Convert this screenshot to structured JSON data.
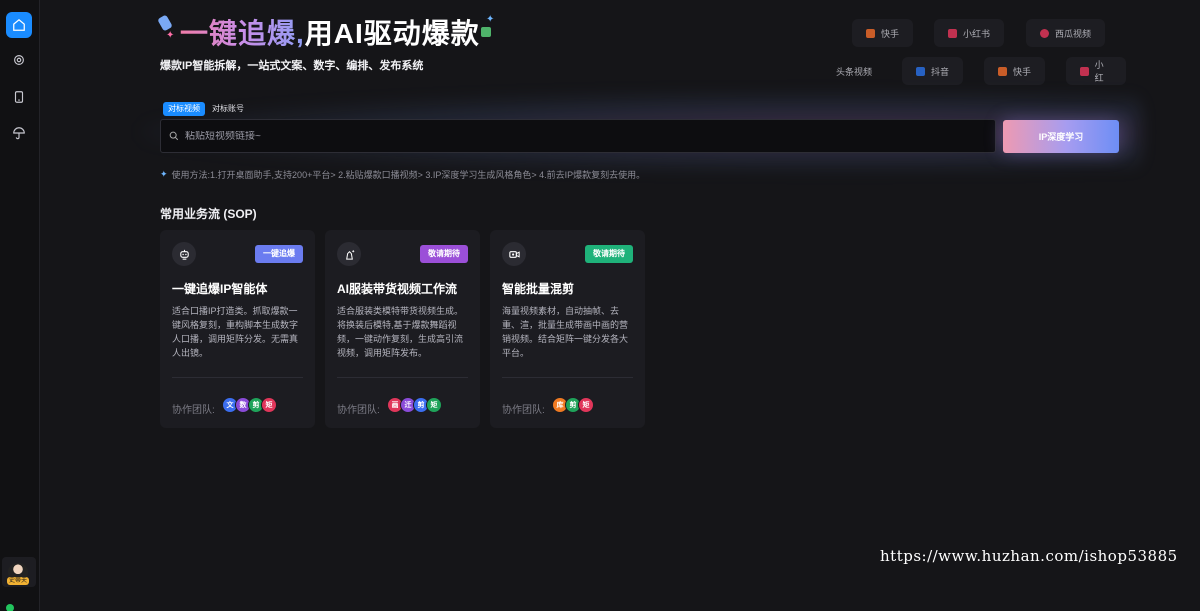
{
  "hero": {
    "title_highlight": "一键追爆,",
    "title_rest": "用AI驱动爆款",
    "subtitle": "爆款IP智能拆解，一站式文案、数字、编排、发布系统"
  },
  "platforms_row1": [
    "快手",
    "小红书",
    "西瓜视频"
  ],
  "platforms_row2": [
    "头条视频",
    "抖音",
    "快手",
    "小红"
  ],
  "tabs": [
    "对标视频",
    "对标账号"
  ],
  "search": {
    "placeholder": "粘贴短视频链接~",
    "button_label": "IP深度学习"
  },
  "hint": "使用方法:1.打开桌面助手,支持200+平台> 2.粘贴爆款口播视频> 3.IP深度学习生成风格角色> 4.前去IP爆款复刻去使用。",
  "sop": {
    "section_title": "常用业务流 (SOP)",
    "team_label": "协作团队:",
    "cards": [
      {
        "badge": "一键追爆",
        "badge_color": "#6b7cf0",
        "title": "一键追爆IP智能体",
        "desc": "适合口播IP打造类。抓取爆款一键风格复刻，重构脚本生成数字人口播，调用矩阵分发。无需真人出镜。",
        "team": [
          "文",
          "数",
          "剪",
          "矩"
        ],
        "team_colors": [
          "#3b6ef0",
          "#8a4bd8",
          "#1fa35a",
          "#e0365a"
        ]
      },
      {
        "badge": "敬请期待",
        "badge_color": "#9b4fd8",
        "title": "AI服装带货视频工作流",
        "desc": "适合服装类模特带货视频生成。将换装后模特,基于爆款舞蹈视频，一键动作复刻，生成高引流视频，调用矩阵发布。",
        "team": [
          "画",
          "迁",
          "剪",
          "矩"
        ],
        "team_colors": [
          "#e0365a",
          "#8a4bd8",
          "#3b6ef0",
          "#1fa35a"
        ]
      },
      {
        "badge": "敬请期待",
        "badge_color": "#1fb27a",
        "title": "智能批量混剪",
        "desc": "海量视频素材，自动抽帧、去重、渲，批量生成带画中画的营销视频。结合矩阵一键分发各大平台。",
        "team": [
          "库",
          "剪",
          "矩"
        ],
        "team_colors": [
          "#f07a22",
          "#1fa35a",
          "#e0365a"
        ]
      }
    ]
  },
  "user": {
    "tag": "史蒂夫"
  },
  "watermark": "https://www.huzhan.com/ishop53885",
  "colors": {
    "accent": "#1a8cff",
    "background": "#151518"
  }
}
